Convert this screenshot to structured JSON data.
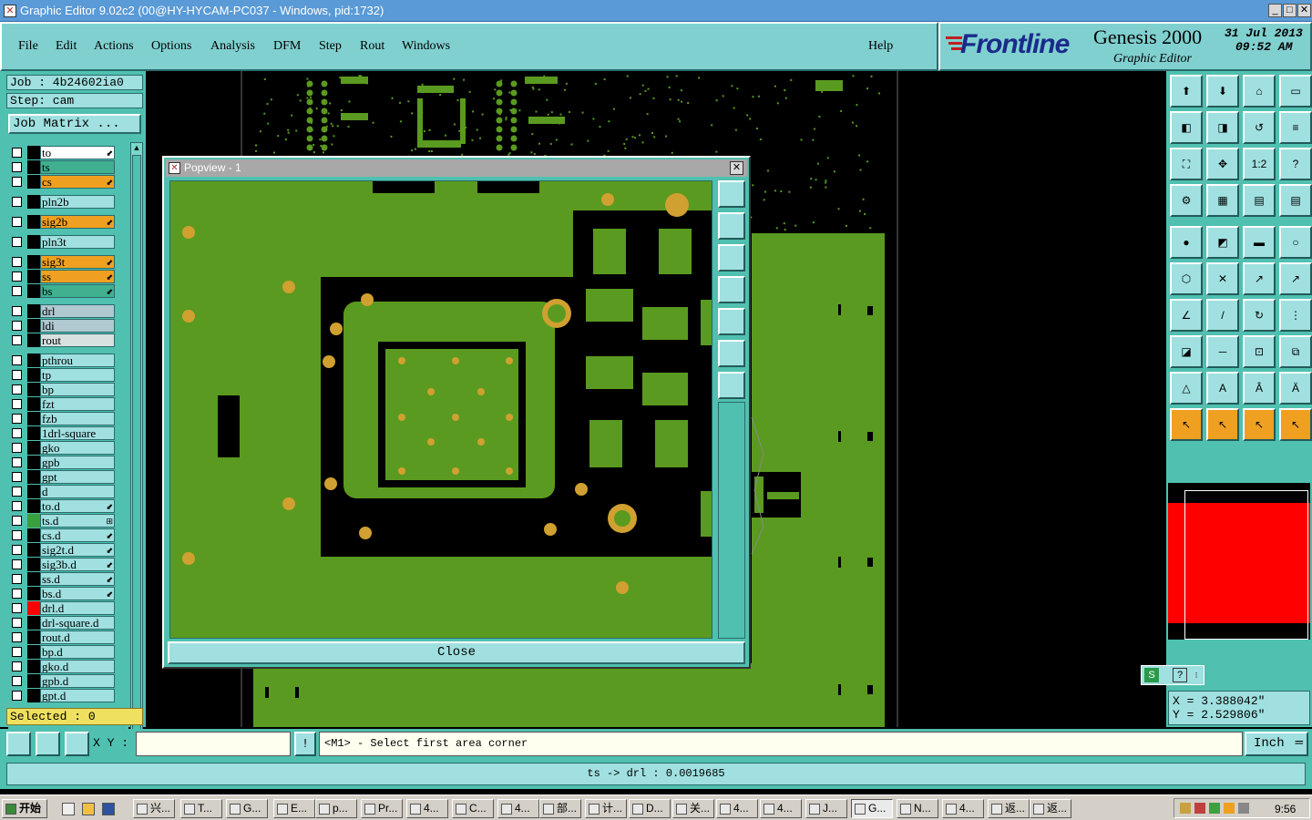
{
  "window": {
    "title": "Graphic Editor 9.02c2 (00@HY-HYCAM-PC037 - Windows, pid:1732)"
  },
  "menu": [
    "File",
    "Edit",
    "Actions",
    "Options",
    "Analysis",
    "DFM",
    "Step",
    "Rout",
    "Windows"
  ],
  "help_label": "Help",
  "logo": {
    "brand": "Frontline",
    "product": "Genesis 2000",
    "sub": "Graphic Editor",
    "date": "31 Jul 2013",
    "time": "09:52 AM"
  },
  "job": {
    "job_label": "Job : 4b24602ia0",
    "step_label": "Step: cam",
    "matrix_button": "Job Matrix ..."
  },
  "colors": {
    "teal": "#50c0b0",
    "light": "#a0e0e0",
    "green": "#5a9a20",
    "pad": "#d0a030",
    "orange": "#f0a020",
    "red": "#ff0000"
  },
  "layers": [
    {
      "name": "to",
      "color": "#000000",
      "fill": "#ffffff",
      "flag": "⬋"
    },
    {
      "name": "ts",
      "color": "#000000",
      "fill": "#40b090",
      "flag": ""
    },
    {
      "name": "cs",
      "color": "#000000",
      "fill": "#f0a020",
      "flag": "⬋"
    },
    {
      "name": "pln2b",
      "color": "#000000",
      "fill": "#a0e0e0",
      "flag": ""
    },
    {
      "name": "sig2b",
      "color": "#000000",
      "fill": "#f0a020",
      "flag": "⬋"
    },
    {
      "name": "pln3t",
      "color": "#000000",
      "fill": "#a0e0e0",
      "flag": ""
    },
    {
      "name": "sig3t",
      "color": "#000000",
      "fill": "#f0a020",
      "flag": "⬋"
    },
    {
      "name": "ss",
      "color": "#000000",
      "fill": "#f0a020",
      "flag": "⬋"
    },
    {
      "name": "bs",
      "color": "#000000",
      "fill": "#40b090",
      "flag": "⬋"
    },
    {
      "name": "drl",
      "color": "#000000",
      "fill": "#b0c8d0",
      "flag": ""
    },
    {
      "name": "ldi",
      "color": "#000000",
      "fill": "#b0c8d0",
      "flag": ""
    },
    {
      "name": "rout",
      "color": "#000000",
      "fill": "#d8e0e0",
      "flag": ""
    },
    {
      "name": "pthrou",
      "color": "#000000",
      "fill": "#a0e0e0",
      "flag": ""
    },
    {
      "name": "tp",
      "color": "#000000",
      "fill": "#a0e0e0",
      "flag": ""
    },
    {
      "name": "bp",
      "color": "#000000",
      "fill": "#a0e0e0",
      "flag": ""
    },
    {
      "name": "fzt",
      "color": "#000000",
      "fill": "#a0e0e0",
      "flag": ""
    },
    {
      "name": "fzb",
      "color": "#000000",
      "fill": "#a0e0e0",
      "flag": ""
    },
    {
      "name": "1drl-square",
      "color": "#000000",
      "fill": "#a0e0e0",
      "flag": ""
    },
    {
      "name": "gko",
      "color": "#000000",
      "fill": "#a0e0e0",
      "flag": ""
    },
    {
      "name": "gpb",
      "color": "#000000",
      "fill": "#a0e0e0",
      "flag": ""
    },
    {
      "name": "gpt",
      "color": "#000000",
      "fill": "#a0e0e0",
      "flag": ""
    },
    {
      "name": "d",
      "color": "#000000",
      "fill": "#a0e0e0",
      "flag": ""
    },
    {
      "name": "to.d",
      "color": "#000000",
      "fill": "#a0e0e0",
      "flag": "⬋"
    },
    {
      "name": "ts.d",
      "color": "#3aa040",
      "fill": "#a0e0e0",
      "flag": "⊞"
    },
    {
      "name": "cs.d",
      "color": "#000000",
      "fill": "#a0e0e0",
      "flag": "⬋"
    },
    {
      "name": "sig2t.d",
      "color": "#000000",
      "fill": "#a0e0e0",
      "flag": "⬋"
    },
    {
      "name": "sig3b.d",
      "color": "#000000",
      "fill": "#a0e0e0",
      "flag": "⬋"
    },
    {
      "name": "ss.d",
      "color": "#000000",
      "fill": "#a0e0e0",
      "flag": "⬋"
    },
    {
      "name": "bs.d",
      "color": "#000000",
      "fill": "#a0e0e0",
      "flag": "⬋"
    },
    {
      "name": "drl.d",
      "color": "#ff0000",
      "fill": "#a0e0e0",
      "flag": ""
    },
    {
      "name": "drl-square.d",
      "color": "#000000",
      "fill": "#a0e0e0",
      "flag": ""
    },
    {
      "name": "rout.d",
      "color": "#000000",
      "fill": "#a0e0e0",
      "flag": ""
    },
    {
      "name": "bp.d",
      "color": "#000000",
      "fill": "#a0e0e0",
      "flag": ""
    },
    {
      "name": "gko.d",
      "color": "#000000",
      "fill": "#a0e0e0",
      "flag": ""
    },
    {
      "name": "gpb.d",
      "color": "#000000",
      "fill": "#a0e0e0",
      "flag": ""
    },
    {
      "name": "gpt.d",
      "color": "#000000",
      "fill": "#a0e0e0",
      "flag": ""
    }
  ],
  "selected_label": "Selected : 0",
  "popview": {
    "title": "Popview - 1",
    "close_label": "Close"
  },
  "coords": {
    "x": "X = 3.388042\"",
    "y": "Y = 2.529806\""
  },
  "command": {
    "xy_label": "X Y :",
    "xy_value": "",
    "prompt": "<M1> - Select first area corner",
    "units": "Inch"
  },
  "status": {
    "message": "ts -> drl : 0.0019685"
  },
  "taskbar": {
    "start": "开始",
    "items": [
      "兴...",
      "T...",
      "G...",
      "E...",
      "p...",
      "Pr...",
      "4...",
      "C...",
      "4...",
      "部...",
      "计...",
      "D...",
      "关...",
      "4...",
      "4...",
      "J...",
      "G...",
      "N...",
      "4...",
      "返...",
      "返..."
    ],
    "clock": "9:56"
  },
  "overview_colors": {
    "board": "#ff0000"
  }
}
